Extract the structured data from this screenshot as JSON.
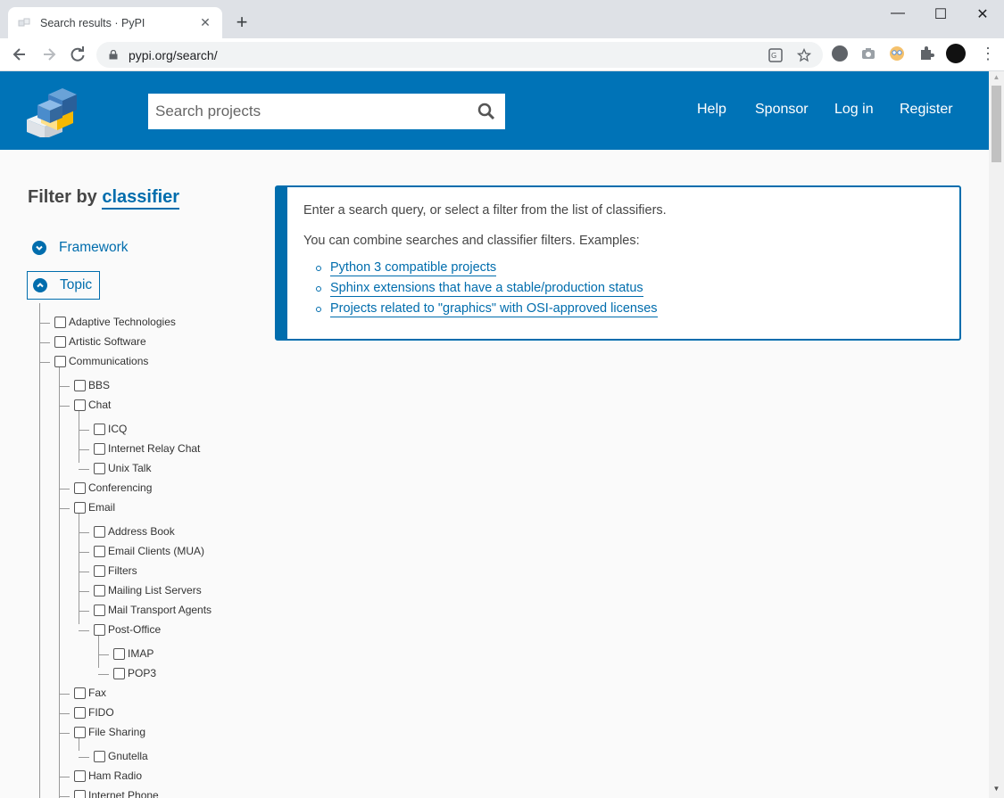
{
  "browser": {
    "tab_title": "Search results · PyPI",
    "tab_close": "✕",
    "new_tab": "+",
    "url": "pypi.org/search/",
    "window_controls": {
      "minimize": "—",
      "maximize": "☐",
      "close": "✕"
    },
    "menu": "⋮"
  },
  "header": {
    "search_placeholder": "Search projects",
    "nav": [
      "Help",
      "Sponsor",
      "Log in",
      "Register"
    ]
  },
  "sidebar": {
    "filter_title": "Filter by",
    "filter_link": "classifier",
    "accordions": [
      {
        "label": "Framework",
        "state": "collapsed"
      },
      {
        "label": "Topic",
        "state": "expanded"
      }
    ],
    "topic_items": [
      "Adaptive Technologies",
      "Artistic Software",
      "Communications",
      "BBS",
      "Chat",
      "ICQ",
      "Internet Relay Chat",
      "Unix Talk",
      "Conferencing",
      "Email",
      "Address Book",
      "Email Clients (MUA)",
      "Filters",
      "Mailing List Servers",
      "Mail Transport Agents",
      "Post-Office",
      "IMAP",
      "POP3",
      "Fax",
      "FIDO",
      "File Sharing",
      "Gnutella",
      "Ham Radio",
      "Internet Phone"
    ]
  },
  "info": {
    "line1": "Enter a search query, or select a filter from the list of classifiers.",
    "line2": "You can combine searches and classifier filters. Examples:",
    "examples": [
      "Python 3 compatible projects",
      "Sphinx extensions that have a stable/production status",
      "Projects related to \"graphics\" with OSI-approved licenses"
    ]
  },
  "colors": {
    "brand": "#0073b7",
    "link": "#006dad"
  }
}
